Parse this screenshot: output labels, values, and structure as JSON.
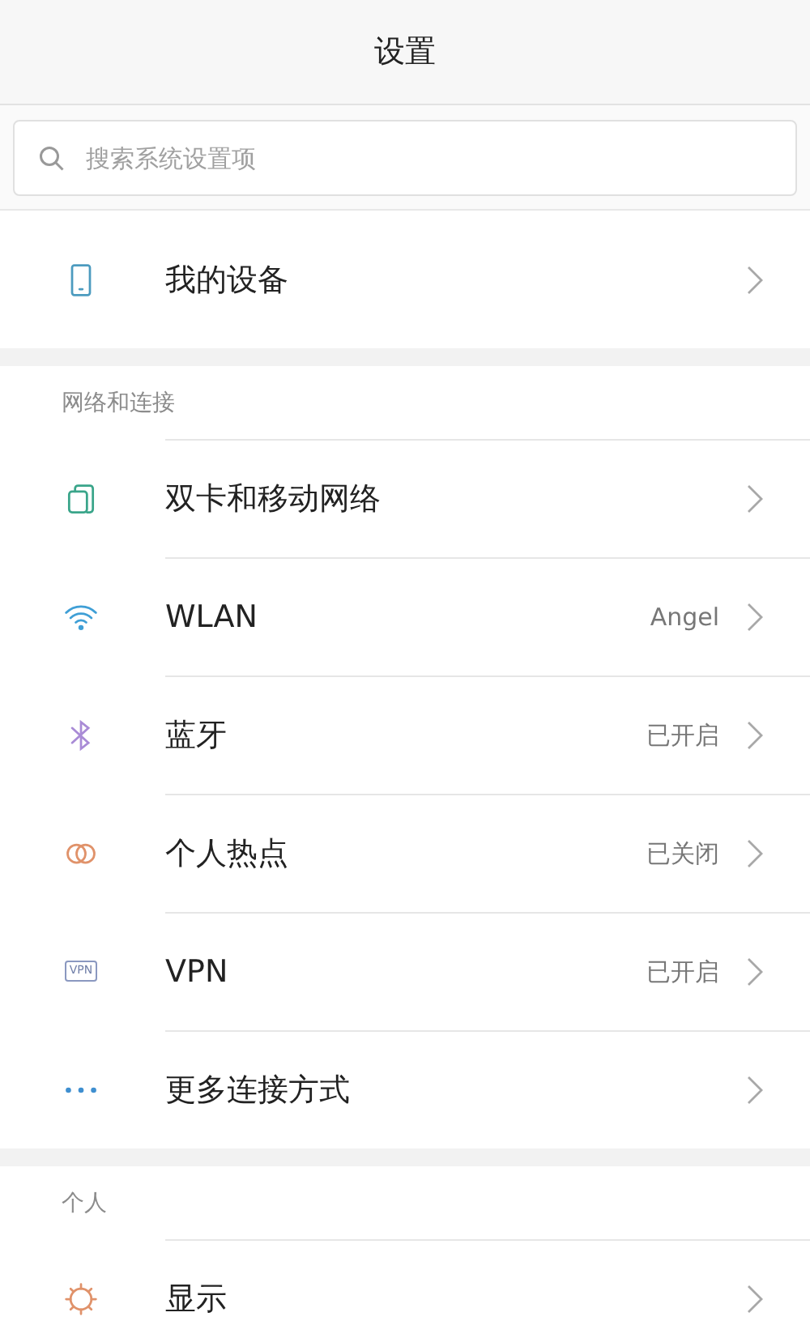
{
  "header": {
    "title": "设置"
  },
  "search": {
    "placeholder": "搜索系统设置项"
  },
  "sections": [
    {
      "items": [
        {
          "kind": "phone",
          "label": "我的设备"
        }
      ]
    },
    {
      "title": "网络和连接",
      "items": [
        {
          "kind": "sim",
          "label": "双卡和移动网络"
        },
        {
          "kind": "wifi",
          "label": "WLAN",
          "value": "Angel"
        },
        {
          "kind": "bluetooth",
          "label": "蓝牙",
          "value": "已开启"
        },
        {
          "kind": "hotspot",
          "label": "个人热点",
          "value": "已关闭"
        },
        {
          "kind": "vpn",
          "icon_text": "VPN",
          "label": "VPN",
          "value": "已开启"
        },
        {
          "kind": "more",
          "label": "更多连接方式"
        }
      ]
    },
    {
      "title": "个人",
      "items": [
        {
          "kind": "sun",
          "label": "显示"
        }
      ]
    }
  ]
}
